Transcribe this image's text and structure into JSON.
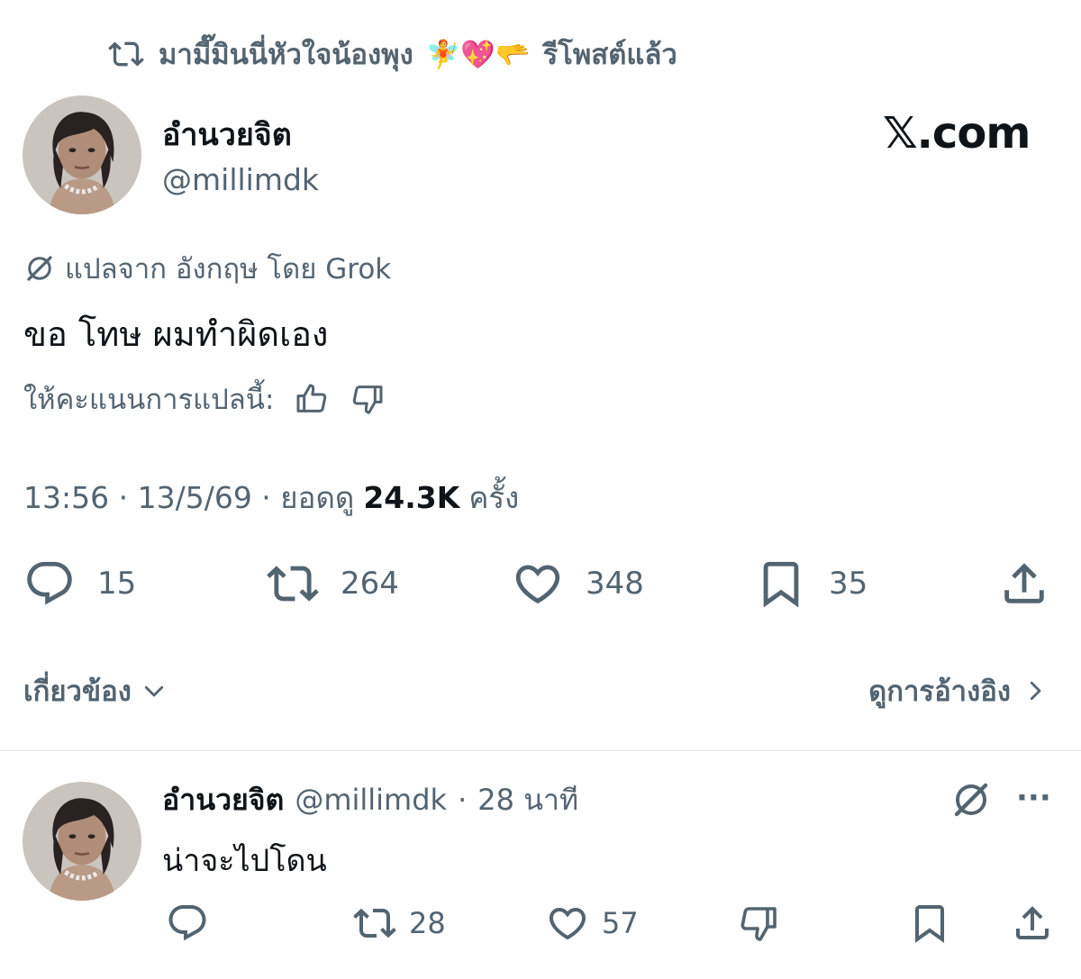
{
  "repost_banner": {
    "icon": "repost-icon",
    "text": "มามี๊มินนี่หัวใจน้องพุง",
    "emojis": "🧚💖🫳",
    "suffix": "รีโพสต์แล้ว"
  },
  "tweet": {
    "display_name": "อำนวยจิต",
    "handle": "@millimdk",
    "brand": "𝕏.com",
    "translated_label": "แปลจาก อังกฤษ โดย Grok",
    "text": "ขอ โทษ ผมทำผิดเอง",
    "rate_label": "ให้คะแนนการแปลนี้:",
    "time": "13:56",
    "date": "13/5/69",
    "views_label": "ยอดดู",
    "views": "24.3K",
    "views_unit": "ครั้ง",
    "actions": {
      "replies": "15",
      "reposts": "264",
      "likes": "348",
      "bookmarks": "35"
    },
    "related_label": "เกี่ยวข้อง",
    "quotes_label": "ดูการอ้างอิง"
  },
  "reply": {
    "display_name": "อำนวยจิต",
    "handle": "@millimdk",
    "time": "28 นาที",
    "more": "···",
    "text": "น่าจะไปโดน",
    "actions": {
      "reposts": "28",
      "likes": "57"
    }
  },
  "colors": {
    "text": "#0f1419",
    "secondary": "#536471",
    "divider": "#e4e8eb"
  }
}
